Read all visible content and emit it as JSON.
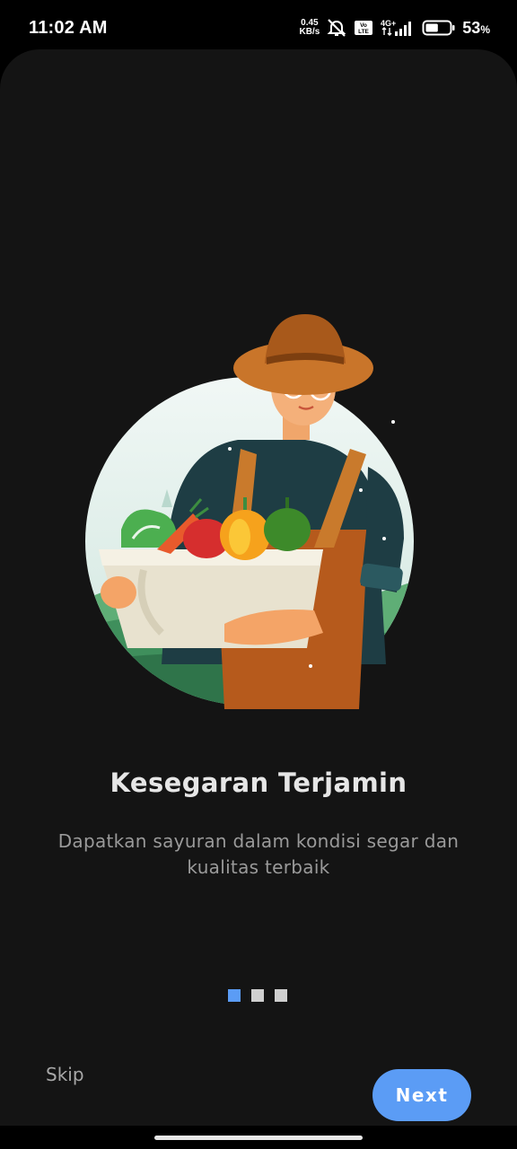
{
  "status_bar": {
    "time": "11:02 AM",
    "net_speed_value": "0.45",
    "net_speed_unit": "KB/s",
    "network_label": "4G+",
    "volte_label": "Vo LTE",
    "battery_percent": "53",
    "battery_symbol": "%",
    "battery_level": 0.53
  },
  "onboarding": {
    "title": "Kesegaran Terjamin",
    "subtitle": "Dapatkan sayuran dalam kondisi segar dan kualitas terbaik",
    "page_indicator": {
      "total": 3,
      "active": 1
    },
    "skip_label": "Skip",
    "next_label": "Next"
  },
  "colors": {
    "background": "#141414",
    "accent": "#5b9cf5",
    "title": "#e6e6e6",
    "subtitle": "#9a9a9a",
    "dot_inactive": "#cfcfcf"
  },
  "icons": [
    "mute-icon",
    "volte-icon",
    "signal-icon",
    "battery-icon",
    "farmer-illustration"
  ]
}
